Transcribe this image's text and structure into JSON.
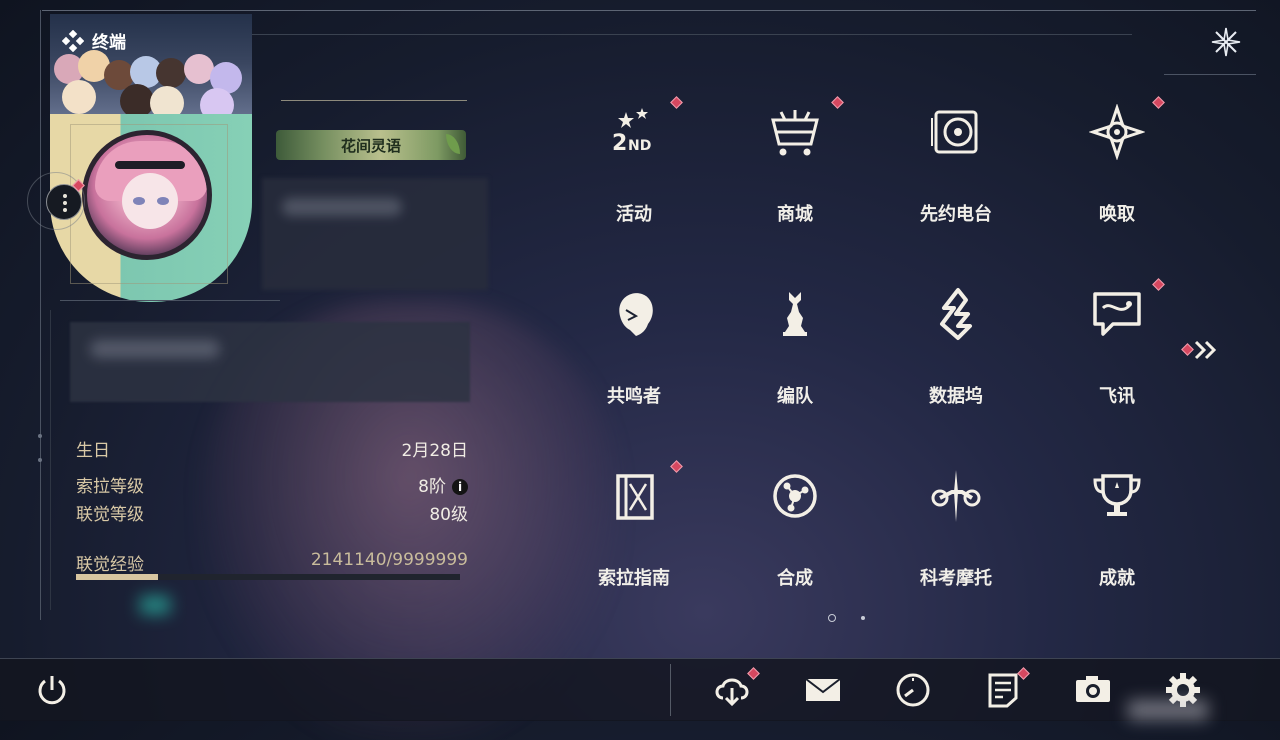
{
  "panel": {
    "title": "终端",
    "profile_title": "花间灵语"
  },
  "stats": {
    "birthday_label": "生日",
    "birthday_value": "2月28日",
    "sola_level_label": "索拉等级",
    "sola_level_value": "8阶",
    "union_level_label": "联觉等级",
    "union_level_value": "80级",
    "union_exp_label": "联觉经验",
    "union_exp_value": "2141140/9999999",
    "union_exp_fraction": 0.2141
  },
  "menu": {
    "items": [
      {
        "label": "活动",
        "icon": "event-2nd-anniversary-icon",
        "badge": true
      },
      {
        "label": "商城",
        "icon": "shop-basket-icon",
        "badge": true
      },
      {
        "label": "先约电台",
        "icon": "radio-pass-icon",
        "badge": false
      },
      {
        "label": "唤取",
        "icon": "convene-compass-icon",
        "badge": true
      },
      {
        "label": "共鸣者",
        "icon": "resonator-head-icon",
        "badge": false
      },
      {
        "label": "编队",
        "icon": "team-chess-icon",
        "badge": false
      },
      {
        "label": "数据坞",
        "icon": "data-bank-icon",
        "badge": false
      },
      {
        "label": "飞讯",
        "icon": "message-chat-icon",
        "badge": true
      },
      {
        "label": "索拉指南",
        "icon": "guide-book-icon",
        "badge": true
      },
      {
        "label": "合成",
        "icon": "synthesis-icon",
        "badge": false
      },
      {
        "label": "科考摩托",
        "icon": "motorcycle-icon",
        "badge": false
      },
      {
        "label": "成就",
        "icon": "achievement-trophy-icon",
        "badge": false
      }
    ],
    "current_page": 1,
    "total_pages": 2
  },
  "bottom_bar": {
    "buttons": [
      "power-icon",
      "download-icon",
      "mail-icon",
      "clock-icon",
      "notice-icon",
      "camera-icon",
      "settings-icon"
    ]
  },
  "colors": {
    "badge": "#d64860",
    "label_gold": "#d9c9a6",
    "exp_fill": "#d8c6a0"
  }
}
